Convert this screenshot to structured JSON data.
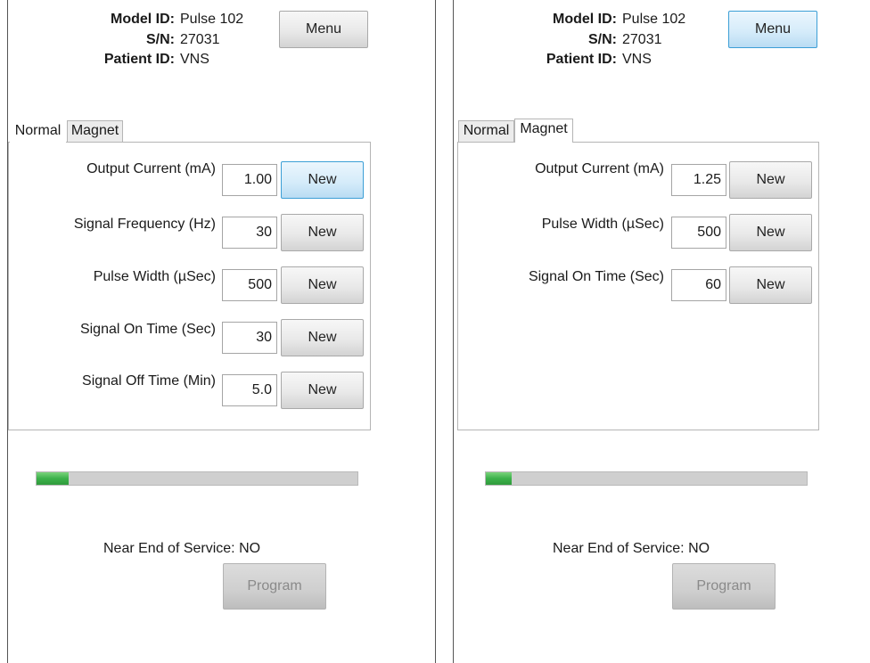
{
  "screens": [
    {
      "header": {
        "model_label": "Model ID:",
        "model_value": "Pulse 102",
        "sn_label": "S/N:",
        "sn_value": "27031",
        "patient_label": "Patient ID:",
        "patient_value": "VNS"
      },
      "menu_label": "Menu",
      "tabs": [
        "Normal",
        "Magnet"
      ],
      "active_tab": "Normal",
      "params": [
        {
          "label": "Output Current (mA)",
          "value": "1.00",
          "button": "New"
        },
        {
          "label": "Signal Frequency (Hz)",
          "value": "30",
          "button": "New"
        },
        {
          "label": "Pulse Width (µSec)",
          "value": "500",
          "button": "New"
        },
        {
          "label": "Signal On Time (Sec)",
          "value": "30",
          "button": "New"
        },
        {
          "label": "Signal Off Time (Min)",
          "value": "5.0",
          "button": "New"
        }
      ],
      "progress_fraction": 0.1,
      "near_end_of_service": "Near End of Service: NO",
      "program_label": "Program"
    },
    {
      "header": {
        "model_label": "Model ID:",
        "model_value": "Pulse 102",
        "sn_label": "S/N:",
        "sn_value": "27031",
        "patient_label": "Patient ID:",
        "patient_value": "VNS"
      },
      "menu_label": "Menu",
      "tabs": [
        "Normal",
        "Magnet"
      ],
      "active_tab": "Magnet",
      "params": [
        {
          "label": "Output Current (mA)",
          "value": "1.25",
          "button": "New"
        },
        {
          "label": "Pulse Width (µSec)",
          "value": "500",
          "button": "New"
        },
        {
          "label": "Signal On Time (Sec)",
          "value": "60",
          "button": "New"
        }
      ],
      "progress_fraction": 0.08,
      "near_end_of_service": "Near End of Service: NO",
      "program_label": "Program"
    }
  ],
  "colors": {
    "accent_focus": "#3c9fd6",
    "progress_green": "#3cb14a",
    "progress_track": "#cfcfcf"
  }
}
